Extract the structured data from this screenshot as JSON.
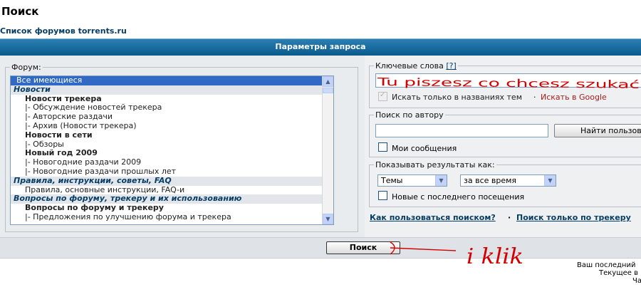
{
  "page": {
    "title": "Поиск",
    "breadcrumb": "Список форумов torrents.ru"
  },
  "header": {
    "title": "Параметры запроса"
  },
  "forum": {
    "legend": "Форум:",
    "options": [
      {
        "label": "Все имеющиеся",
        "kind": "sel"
      },
      {
        "label": "Новости",
        "kind": "cat"
      },
      {
        "label": "Новости трекера",
        "kind": "sub"
      },
      {
        "label": "|- Обсуждение новостей трекера",
        "kind": "child"
      },
      {
        "label": "|- Авторские раздачи",
        "kind": "child"
      },
      {
        "label": "|- Архив (Новости трекера)",
        "kind": "child"
      },
      {
        "label": "Новости в сети",
        "kind": "sub"
      },
      {
        "label": "|- Обзоры",
        "kind": "child"
      },
      {
        "label": "Новый год 2009",
        "kind": "sub"
      },
      {
        "label": "|- Новогодние раздачи 2009",
        "kind": "child"
      },
      {
        "label": "|- Новогодние раздачи прошлых лет",
        "kind": "child"
      },
      {
        "label": "Правила, инструкции, советы, FAQ",
        "kind": "cat"
      },
      {
        "label": "Правила, основные инструкции, FAQ-и",
        "kind": "child"
      },
      {
        "label": "Вопросы по форуму, трекеру и их использованию",
        "kind": "cat"
      },
      {
        "label": "Вопросы по форуму и трекеру",
        "kind": "sub"
      },
      {
        "label": "|- Предложения по улучшению форума и трекера",
        "kind": "child"
      }
    ]
  },
  "keywords": {
    "legend": "Ключевые слова",
    "help": "[?]",
    "value": "",
    "only_titles_label": "Искать только в названиях тем",
    "separator": "·",
    "google_link": "Искать в Google"
  },
  "author": {
    "legend": "Поиск по автору",
    "value": "",
    "find_button": "Найти пользов",
    "my_messages_label": "Мои сообщения"
  },
  "display": {
    "legend": "Показывать результаты как:",
    "type_selected": "Темы",
    "time_selected": "за все время",
    "new_since_label": "Новые с последнего посещения"
  },
  "links": {
    "how_to": "Как пользоваться поиском?",
    "separator": "·",
    "tracker_only": "Поиск только по трекеру"
  },
  "submit": {
    "label": "Поиск"
  },
  "footer": {
    "line1": "Ваш последний",
    "line2": "Текущее в",
    "line3": "Ча"
  },
  "annotations": {
    "keyword_scribble": "Tu piszesz co chcesz szukać",
    "click_note": "i klik"
  },
  "colors": {
    "header_bar": "#0a5b8c",
    "link": "#063d65",
    "scribble": "#d40000",
    "selected": "#316ac5"
  }
}
